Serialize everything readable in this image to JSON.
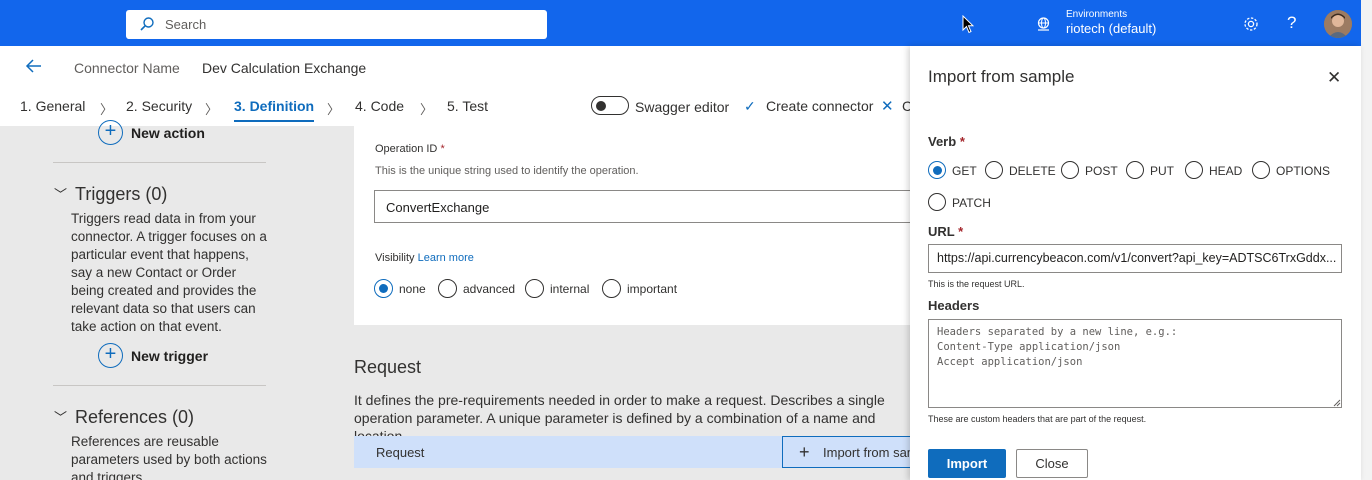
{
  "topbar": {
    "search_placeholder": "Search",
    "env_label": "Environments",
    "env_value": "riotech (default)",
    "help_glyph": "?"
  },
  "header": {
    "connector_name_label": "Connector Name",
    "connector_name_value": "Dev Calculation Exchange",
    "steps": [
      "1. General",
      "2. Security",
      "3. Definition",
      "4. Code",
      "5. Test"
    ],
    "active_step": "3. Definition",
    "swagger_editor": "Swagger editor",
    "create_connector": "Create connector",
    "close_partial": "C"
  },
  "sidebar": {
    "new_action": "New action",
    "triggers_title": "Triggers (0)",
    "triggers_desc": "Triggers read data in from your connector. A trigger focuses on a particular event that happens, say a new Contact or Order being created and provides the relevant data so that users can take action on that event.",
    "new_trigger": "New trigger",
    "references_title": "References (0)",
    "references_desc": "References are reusable parameters used by both actions and triggers."
  },
  "operation": {
    "id_label": "Operation ID",
    "required_mark": "*",
    "id_help": "This is the unique string used to identify the operation.",
    "id_value": "ConvertExchange",
    "visibility_label": "Visibility",
    "learn_more": "Learn more",
    "visibility_options": [
      "none",
      "advanced",
      "internal",
      "important"
    ],
    "visibility_selected": "none"
  },
  "request": {
    "title": "Request",
    "desc": "It defines the pre-requirements needed in order to make a request. Describes a single operation parameter. A unique parameter is defined by a combination of a name and location.",
    "bar_label": "Request",
    "import_from_sample": "Import from sample"
  },
  "panel": {
    "title": "Import from sample",
    "verb_label": "Verb",
    "required_mark": "*",
    "verbs": [
      "GET",
      "DELETE",
      "POST",
      "PUT",
      "HEAD",
      "OPTIONS",
      "PATCH"
    ],
    "verb_selected": "GET",
    "url_label": "URL",
    "url_value": "https://api.currencybeacon.com/v1/convert?api_key=ADTSC6TrxGddx...",
    "url_help": "This is the request URL.",
    "headers_label": "Headers",
    "headers_placeholder": "Headers separated by a new line, e.g.:\nContent-Type application/json\nAccept application/json",
    "headers_help": "These are custom headers that are part of the request.",
    "import_button": "Import",
    "close_button": "Close"
  },
  "colors": {
    "topbar": "#1266ec",
    "accent": "#0f6cbd",
    "required": "#a4262c"
  }
}
